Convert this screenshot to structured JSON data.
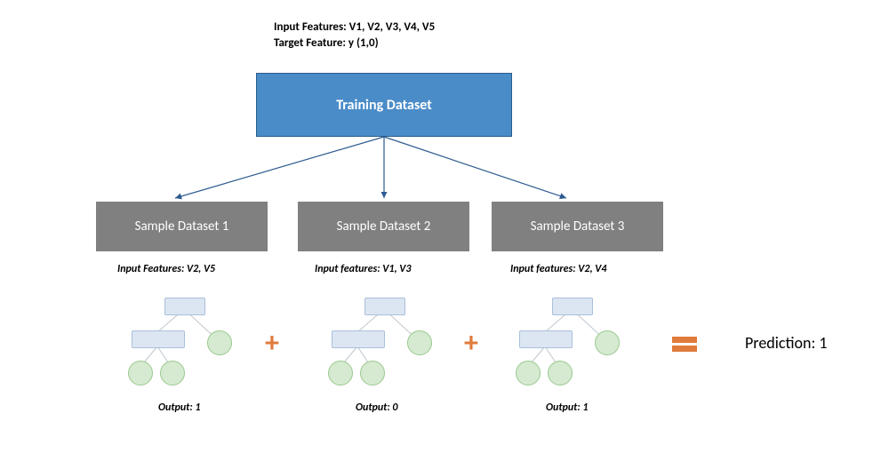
{
  "header": {
    "line1": "Input Features: V1, V2, V3, V4, V5",
    "line2": "Target Feature: y (1,0)"
  },
  "training": {
    "label": "Training Dataset"
  },
  "samples": [
    {
      "label": "Sample Dataset 1",
      "features": "Input Features: V2, V5",
      "output": "Output: 1"
    },
    {
      "label": "Sample Dataset 2",
      "features": "Input features: V1, V3",
      "output": "Output: 0"
    },
    {
      "label": "Sample Dataset 3",
      "features": "Input features: V2, V4",
      "output": "Output: 1"
    }
  ],
  "operators": {
    "plus": "+",
    "equals": "="
  },
  "prediction": {
    "label": "Prediction: 1"
  },
  "colors": {
    "trainingFill": "#4A8CC8",
    "sampleFill": "#808080",
    "operator": "#E07B3C",
    "treeRectFill": "#DCE6F2",
    "treeCircFill": "#D5EAD0",
    "arrow": "#2C5A8F"
  }
}
